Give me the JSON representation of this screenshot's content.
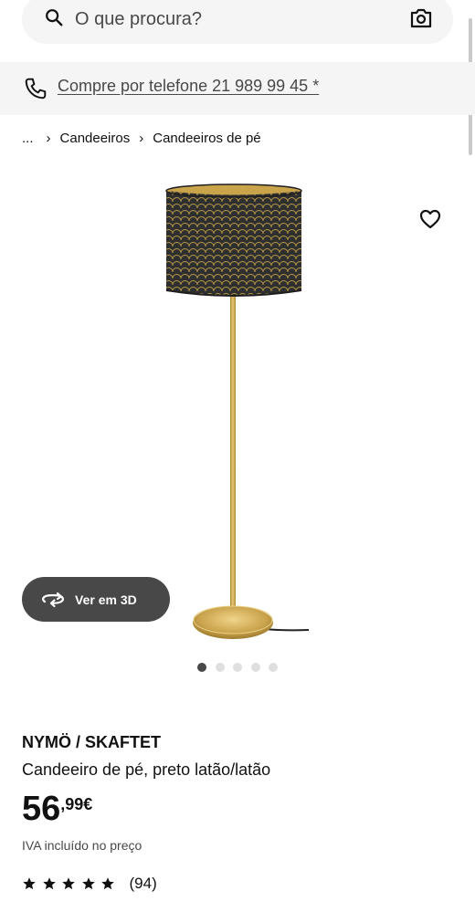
{
  "search": {
    "placeholder": "O que procura?"
  },
  "phone_bar": {
    "label": "Compre por telefone 21 989 99 45 *"
  },
  "breadcrumb": {
    "ellipsis": "...",
    "separator": "›",
    "items": [
      "Candeeiros",
      "Candeeiros de pé"
    ]
  },
  "gallery": {
    "button_3d_label": "Ver em 3D",
    "total_images": 5,
    "active_index": 0
  },
  "product": {
    "name": "NYMÖ / SKAFTET",
    "description": "Candeeiro de pé, preto latão/latão",
    "price_integer": "56",
    "price_decimal": ",99€",
    "vat_note": "IVA incluído no preço",
    "rating": 5,
    "review_count": "(94)"
  },
  "icons": {
    "search": "search-icon",
    "camera": "camera-icon",
    "phone": "phone-icon",
    "favourite": "heart-icon",
    "rotate_3d": "rotate-3d-icon",
    "star": "star-icon"
  },
  "colors": {
    "surface_grey": "#f5f5f5",
    "text_dark": "#111111",
    "text_muted": "#484848",
    "button_3d_bg": "#484848",
    "brass": "#c8a24a"
  }
}
